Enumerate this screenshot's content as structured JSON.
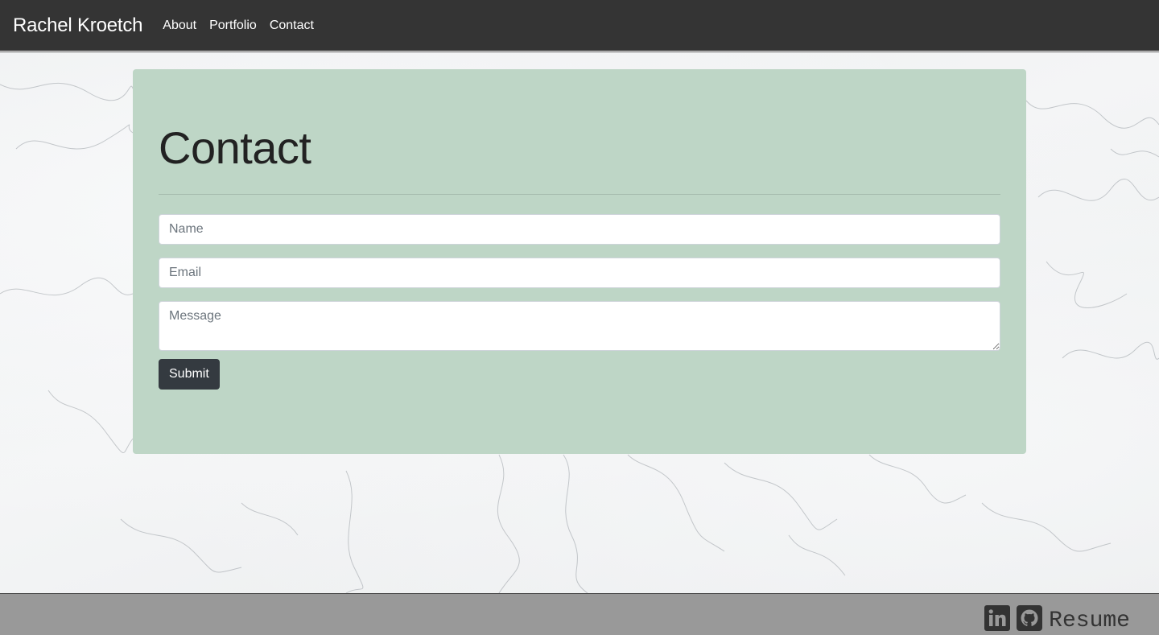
{
  "navbar": {
    "brand": "Rachel Kroetch",
    "links": [
      "About",
      "Portfolio",
      "Contact"
    ]
  },
  "contact": {
    "title": "Contact",
    "name_placeholder": "Name",
    "email_placeholder": "Email",
    "message_placeholder": "Message",
    "submit_label": "Submit"
  },
  "footer": {
    "icons": [
      "linkedin-icon",
      "github-icon"
    ],
    "resume_label": "Resume"
  },
  "colors": {
    "navbar_bg": "#343434",
    "card_bg": "#bed6c6",
    "button_bg": "#343a40",
    "footer_bg": "#999999"
  }
}
